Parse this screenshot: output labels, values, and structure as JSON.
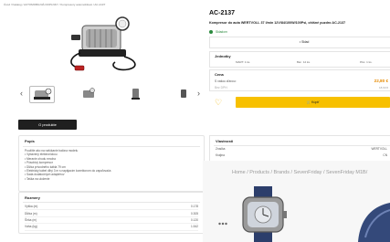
{
  "breadcrumb": "Úvod / Katalog / AUTOMOBILNIÁ DOPLNKY / Kompresory automobilové / AC-2137",
  "thumbs_nav": {
    "prev": "‹",
    "next": "›"
  },
  "about_button": "O produkte",
  "description": {
    "title": "Popis",
    "items": [
      "Použitie ako na nafúkanie balóna modelu",
      "• Vybavený elektronickou",
      "• Meranie ohodu mnoha",
      "• Pôsobivý kompresor",
      "• Dĺžka prívodného kábla 79 cm",
      "• Elektrický kábel dlhý 3 m s napájacím konektorom do zapaľovača",
      "• Sada dodatočných adaptérov",
      "• Taška na uloženie"
    ]
  },
  "dimensions": {
    "title": "Rozmery",
    "rows": [
      {
        "label": "Výška (m)",
        "value": "0.178"
      },
      {
        "label": "Dĺžka (m)",
        "value": "0.305"
      },
      {
        "label": "Šírka (m)",
        "value": "0.120"
      },
      {
        "label": "Váha (kg)",
        "value": "1.542"
      }
    ]
  },
  "product": {
    "code": "AC-2137",
    "name": "Kompresor do auta WERTVOLL 37 l/min 12V/84/100W/100Psi, ohišné puzdro AC-2137",
    "stock_label": "Skladom",
    "qty_label": "• Sklad"
  },
  "units": {
    "title": "Jednotky",
    "items": [
      "MART: 1 ks.",
      "Bal.: 12 ks.",
      "PAL: 1 ks."
    ]
  },
  "price": {
    "title": "Cena",
    "line1_label": "S vašou zľavou:",
    "line1_value": "22,80 €",
    "line2_label": "Bez DPH:",
    "line2_value": "18,60 €"
  },
  "buy_button": "🛒 Kúpiť",
  "properties": {
    "title": "Vlastnosti",
    "rows": [
      {
        "label": "Značka",
        "value": "WERTVOLL"
      },
      {
        "label": "Krajina",
        "value": "CN"
      }
    ]
  },
  "overlay": {
    "breadcrumb": "Home / Products / Brands / SevenFriday / SevenFriday M1B/"
  },
  "colors": {
    "accent": "#f7c000",
    "price": "#e68a00",
    "stock": "#2b8a3e",
    "dark_button": "#1f1f1f"
  },
  "icons": [
    "chevron-left-icon",
    "chevron-right-icon",
    "heart-icon",
    "cart-icon",
    "more-icon"
  ]
}
